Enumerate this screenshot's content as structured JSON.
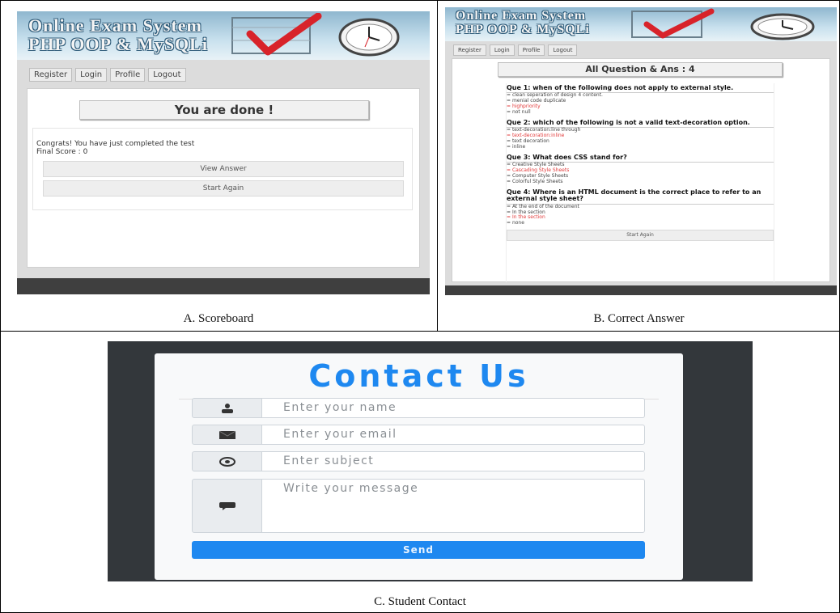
{
  "panel_a": {
    "brand_line1": "Online Exam System",
    "brand_line2": "PHP OOP & MySQLi",
    "nav": [
      "Register",
      "Login",
      "Profile",
      "Logout"
    ],
    "heading": "You are done !",
    "message": "Congrats! You have just completed the test",
    "score": "Final Score : 0",
    "view_answer": "View Answer",
    "start_again": "Start Again",
    "caption": "A. Scoreboard"
  },
  "panel_b": {
    "brand_line1": "Online Exam System",
    "brand_line2": "PHP OOP & MySQLi",
    "nav": [
      "Register",
      "Login",
      "Profile",
      "Logout"
    ],
    "heading": "All Question & Ans : 4",
    "questions": [
      {
        "text": "Que 1: when of the following does not apply to external style.",
        "options": [
          "clean seperation of design 4 content.",
          "menial code duplicate",
          "highpriority",
          "not null"
        ],
        "correct": 2
      },
      {
        "text": "Que 2: which of the following is not a valid text-decoration option.",
        "options": [
          "text-decoration:line through",
          "text-decoration:inline",
          "text decoration",
          "inline"
        ],
        "correct": 1
      },
      {
        "text": "Que 3: What does CSS stand for?",
        "options": [
          "Creative Style Sheets",
          "Cascading Style Sheets",
          "Computer Style Sheets",
          "Colorful Style Sheets"
        ],
        "correct": 1
      },
      {
        "text": "Que 4: Where is an HTML document is the correct place to refer to an external style sheet?",
        "options": [
          "At the end of the document",
          "In the section",
          "In the section",
          "none"
        ],
        "correct": 2
      }
    ],
    "start_again": "Start Again",
    "caption": "B. Correct Answer"
  },
  "panel_c": {
    "title": "Contact Us",
    "name_placeholder": "Enter your name",
    "email_placeholder": "Enter your email",
    "subject_placeholder": "Enter subject",
    "message_placeholder": "Write your message",
    "send": "Send",
    "caption": "C. Student Contact"
  },
  "icons": {
    "name": "user-icon",
    "email": "envelope-icon",
    "subject": "at-sign-icon",
    "message": "comment-icon",
    "banner": [
      "checkmark-icon",
      "clock-icon"
    ]
  },
  "colors": {
    "accent_blue": "#1e88f0",
    "correct_red": "#e23a3a",
    "footer_dark": "#3f3f3f",
    "contact_bg": "#33373b"
  }
}
